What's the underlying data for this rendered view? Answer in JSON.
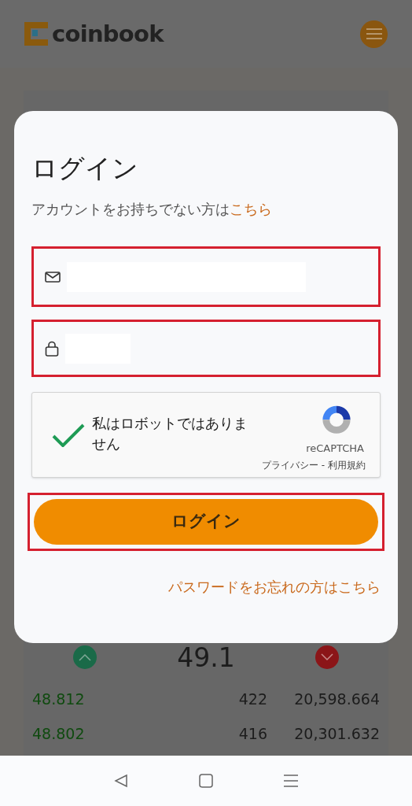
{
  "header": {
    "logo": "coinbook"
  },
  "market": {
    "price": "49.1",
    "rows": [
      {
        "price": "48.812",
        "amount": "422",
        "total": "20,598.664"
      },
      {
        "price": "48.802",
        "amount": "416",
        "total": "20,301.632"
      }
    ]
  },
  "login_dialog": {
    "title": "ログイン",
    "signup_prompt": "アカウントをお持ちでない方は",
    "signup_link": "こちら",
    "fields": [
      {
        "kind": "email",
        "highlighted": true
      },
      {
        "kind": "password",
        "highlighted": true
      }
    ],
    "captcha": {
      "checked": true,
      "label": "私はロボットではありません",
      "brand": "reCAPTCHA",
      "privacy": "プライバシー",
      "separator": "-",
      "terms": "利用規約"
    },
    "login_button": {
      "label": "ログイン",
      "highlighted": true
    },
    "forgot_link": "パスワードをお忘れの方はこちら"
  }
}
